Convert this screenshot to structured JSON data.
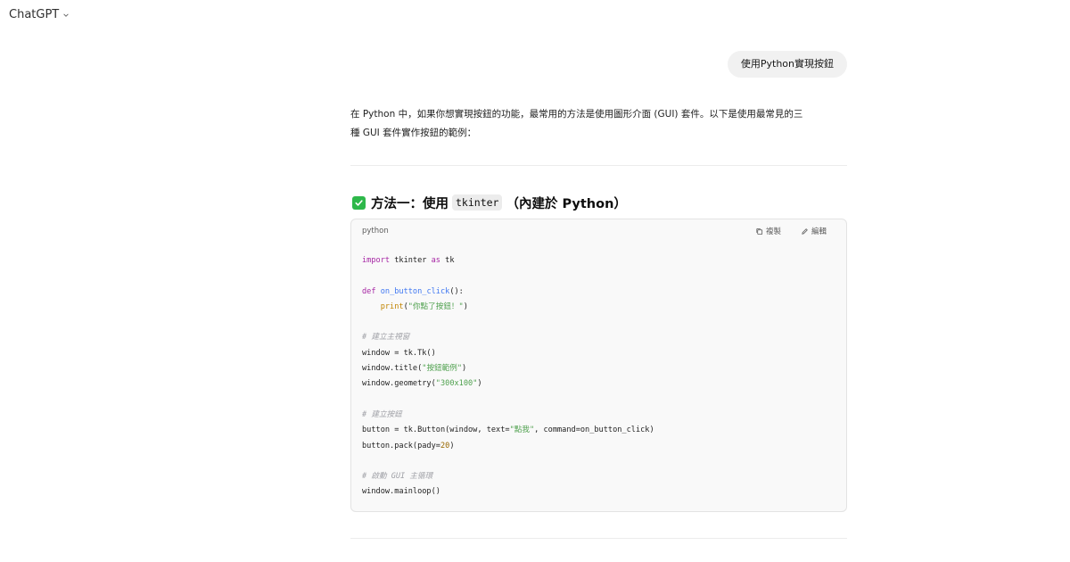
{
  "header": {
    "model_name": "ChatGPT",
    "chevron_icon": "chevron-down-icon"
  },
  "conversation": {
    "user_message": "使用Python實現按鈕",
    "assistant": {
      "intro_line_1": "在 Python 中，如果你想實現按鈕的功能，最常用的方法是使用圖形介面 (GUI) 套件。以下是使用最常見的三",
      "intro_line_2": "種 GUI 套件實作按鈕的範例：",
      "section_1": {
        "icon": "check-mark-icon",
        "title_prefix": "方法一：使用",
        "title_code": "tkinter",
        "title_suffix": "（內建於 Python）"
      },
      "code_block": {
        "language": "python",
        "copy_label": "複製",
        "edit_label": "編輯",
        "lines": [
          "import tkinter as tk",
          "",
          "def on_button_click():",
          "    print(\"你點了按鈕！\")",
          "",
          "# 建立主視窗",
          "window = tk.Tk()",
          "window.title(\"按鈕範例\")",
          "window.geometry(\"300x100\")",
          "",
          "# 建立按鈕",
          "button = tk.Button(window, text=\"點我\", command=on_button_click)",
          "button.pack(pady=20)",
          "",
          "# 啟動 GUI 主循環",
          "window.mainloop()"
        ]
      }
    }
  },
  "colors": {
    "check_icon": "#2eb84a",
    "user_bubble_bg": "#f1f1f1",
    "code_bg": "#f9f9f9",
    "keyword": "#a626a4",
    "function": "#4078f2",
    "builtin": "#c18401",
    "string": "#50a14f",
    "number": "#986801",
    "comment": "#a0a1a7"
  }
}
